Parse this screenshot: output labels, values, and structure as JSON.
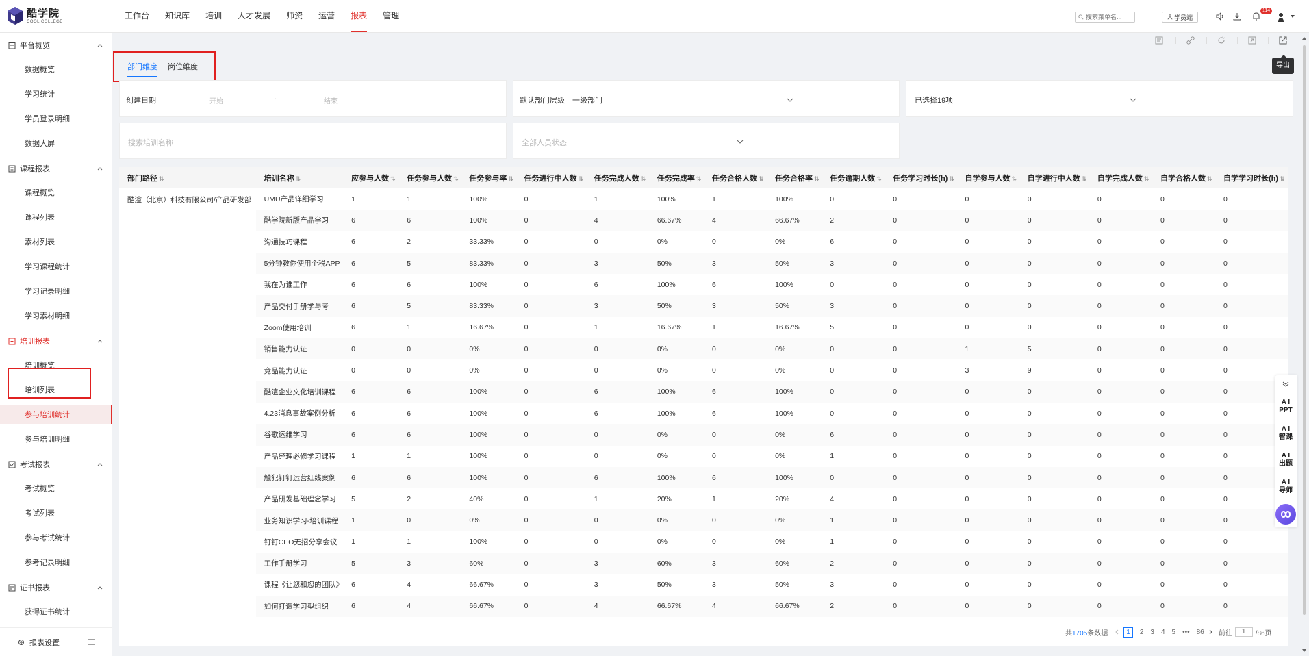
{
  "brand": {
    "name_cn": "酷学院",
    "name_en": "COOL COLLEGE"
  },
  "nav": [
    "工作台",
    "知识库",
    "培训",
    "人才发展",
    "师资",
    "运营",
    "报表",
    "管理"
  ],
  "nav_active_index": 6,
  "topbar": {
    "search_placeholder": "搜索菜单名...",
    "student_label": "学员端",
    "notification_count": "114"
  },
  "sidebar": {
    "groups": [
      {
        "label": "平台概览",
        "items": [
          "数据概览",
          "学习统计",
          "学员登录明细",
          "数据大屏"
        ]
      },
      {
        "label": "课程报表",
        "items": [
          "课程概览",
          "课程列表",
          "素材列表",
          "学习课程统计",
          "学习记录明细",
          "学习素材明细"
        ]
      },
      {
        "label": "培训报表",
        "items": [
          "培训概览",
          "培训列表",
          "参与培训统计",
          "参与培训明细"
        ]
      },
      {
        "label": "考试报表",
        "items": [
          "考试概览",
          "考试列表",
          "参与考试统计",
          "参考记录明细"
        ]
      },
      {
        "label": "证书报表",
        "items": [
          "获得证书统计"
        ]
      }
    ],
    "active_item": "参与培训统计",
    "footer_label": "报表设置"
  },
  "tooltip": "导出",
  "tabs": [
    "部门维度",
    "岗位维度"
  ],
  "filters": {
    "date_label": "创建日期",
    "date_start": "开始",
    "date_arrow": "→",
    "date_end": "结束",
    "dept_level_label": "默认部门层级",
    "dept_level_value": "一级部门",
    "selected_label": "已选择19项",
    "training_search_placeholder": "搜索培训名称",
    "staff_status_placeholder": "全部人员状态"
  },
  "table": {
    "columns": [
      "部门路径",
      "培训名称",
      "应参与人数",
      "任务参与人数",
      "任务参与率",
      "任务进行中人数",
      "任务完成人数",
      "任务完成率",
      "任务合格人数",
      "任务合格率",
      "任务逾期人数",
      "任务学习时长(h)",
      "自学参与人数",
      "自学进行中人数",
      "自学完成人数",
      "自学合格人数",
      "自学学习时长(h)"
    ],
    "dept": "酷渲（北京）科技有限公司/产品研发部",
    "rows": [
      [
        "UMU产品详细学习",
        "1",
        "1",
        "100%",
        "0",
        "1",
        "100%",
        "1",
        "100%",
        "0",
        "0",
        "0",
        "0",
        "0",
        "0",
        "0"
      ],
      [
        "酷学院新版产品学习",
        "6",
        "6",
        "100%",
        "0",
        "4",
        "66.67%",
        "4",
        "66.67%",
        "2",
        "0",
        "0",
        "0",
        "0",
        "0",
        "0"
      ],
      [
        "沟通技巧课程",
        "6",
        "2",
        "33.33%",
        "0",
        "0",
        "0%",
        "0",
        "0%",
        "6",
        "0",
        "0",
        "0",
        "0",
        "0",
        "0"
      ],
      [
        "5分钟教你使用个税APP",
        "6",
        "5",
        "83.33%",
        "0",
        "3",
        "50%",
        "3",
        "50%",
        "3",
        "0",
        "0",
        "0",
        "0",
        "0",
        "0"
      ],
      [
        "我在为谁工作",
        "6",
        "6",
        "100%",
        "0",
        "6",
        "100%",
        "6",
        "100%",
        "0",
        "0",
        "0",
        "0",
        "0",
        "0",
        "0"
      ],
      [
        "产品交付手册学与考",
        "6",
        "5",
        "83.33%",
        "0",
        "3",
        "50%",
        "3",
        "50%",
        "3",
        "0",
        "0",
        "0",
        "0",
        "0",
        "0"
      ],
      [
        "Zoom使用培训",
        "6",
        "1",
        "16.67%",
        "0",
        "1",
        "16.67%",
        "1",
        "16.67%",
        "5",
        "0",
        "0",
        "0",
        "0",
        "0",
        "0"
      ],
      [
        "销售能力认证",
        "0",
        "0",
        "0%",
        "0",
        "0",
        "0%",
        "0",
        "0%",
        "0",
        "0",
        "1",
        "5",
        "0",
        "0",
        "0"
      ],
      [
        "竞品能力认证",
        "0",
        "0",
        "0%",
        "0",
        "0",
        "0%",
        "0",
        "0%",
        "0",
        "0",
        "3",
        "9",
        "0",
        "0",
        "0"
      ],
      [
        "酷渲企业文化培训课程",
        "6",
        "6",
        "100%",
        "0",
        "6",
        "100%",
        "6",
        "100%",
        "0",
        "0",
        "0",
        "0",
        "0",
        "0",
        "0"
      ],
      [
        "4.23消息事故案例分析",
        "6",
        "6",
        "100%",
        "0",
        "6",
        "100%",
        "6",
        "100%",
        "0",
        "0",
        "0",
        "0",
        "0",
        "0",
        "0"
      ],
      [
        "谷歌运维学习",
        "6",
        "6",
        "100%",
        "0",
        "0",
        "0%",
        "0",
        "0%",
        "6",
        "0",
        "0",
        "0",
        "0",
        "0",
        "0"
      ],
      [
        "产品经理必修学习课程",
        "1",
        "1",
        "100%",
        "0",
        "0",
        "0%",
        "0",
        "0%",
        "1",
        "0",
        "0",
        "0",
        "0",
        "0",
        "0"
      ],
      [
        "触犯钉钉运营红线案例",
        "6",
        "6",
        "100%",
        "0",
        "6",
        "100%",
        "6",
        "100%",
        "0",
        "0",
        "0",
        "0",
        "0",
        "0",
        "0"
      ],
      [
        "产品研发基础理念学习",
        "5",
        "2",
        "40%",
        "0",
        "1",
        "20%",
        "1",
        "20%",
        "4",
        "0",
        "0",
        "0",
        "0",
        "0",
        "0"
      ],
      [
        "业务知识学习-培训课程",
        "1",
        "0",
        "0%",
        "0",
        "0",
        "0%",
        "0",
        "0%",
        "1",
        "0",
        "0",
        "0",
        "0",
        "0",
        "0"
      ],
      [
        "钉钉CEO无招分享会议",
        "1",
        "1",
        "100%",
        "0",
        "0",
        "0%",
        "0",
        "0%",
        "1",
        "0",
        "0",
        "0",
        "0",
        "0",
        "0"
      ],
      [
        "工作手册学习",
        "5",
        "3",
        "60%",
        "0",
        "3",
        "60%",
        "3",
        "60%",
        "2",
        "0",
        "0",
        "0",
        "0",
        "0",
        "0"
      ],
      [
        "课程《让您和您的团队》",
        "6",
        "4",
        "66.67%",
        "0",
        "3",
        "50%",
        "3",
        "50%",
        "3",
        "0",
        "0",
        "0",
        "0",
        "0",
        "0"
      ],
      [
        "如何打造学习型组织",
        "6",
        "4",
        "66.67%",
        "0",
        "4",
        "66.67%",
        "4",
        "66.67%",
        "2",
        "0",
        "0",
        "0",
        "0",
        "0",
        "0"
      ]
    ]
  },
  "pagination": {
    "total_prefix": "共",
    "total_count": "1705",
    "total_suffix": "条数据",
    "pages": [
      "1",
      "2",
      "3",
      "4",
      "5",
      "•••",
      "86"
    ],
    "goto_label": "前往",
    "goto_value": "1",
    "total_pages": "/86页"
  },
  "ai_panel": {
    "items": [
      "A I\nPPT",
      "A I\n智课",
      "A I\n出题",
      "A I\n导师"
    ]
  },
  "colors": {
    "accent_red": "#e0312d",
    "link_blue": "#1677ff",
    "highlight_box": "#e02020",
    "ai_purple": "#6b52e8"
  }
}
